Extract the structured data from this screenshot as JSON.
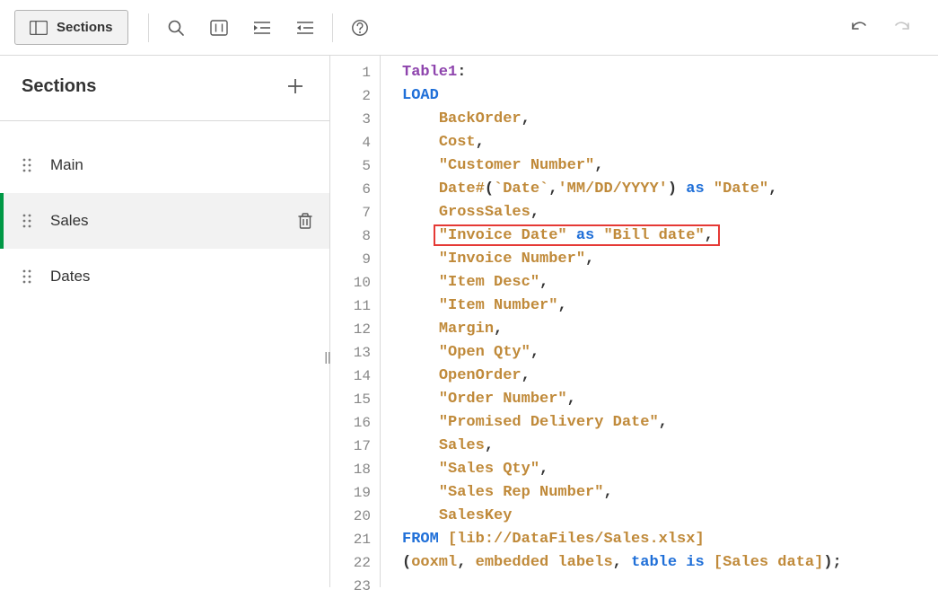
{
  "toolbar": {
    "sections_label": "Sections"
  },
  "sidebar": {
    "title": "Sections",
    "items": [
      {
        "label": "Main",
        "active": false
      },
      {
        "label": "Sales",
        "active": true
      },
      {
        "label": "Dates",
        "active": false
      }
    ]
  },
  "editor": {
    "highlighted_line": 8,
    "lines": [
      {
        "n": 1,
        "indent": 0,
        "tokens": [
          {
            "t": "Table1",
            "c": "tablename"
          },
          {
            "t": ":",
            "c": "punc"
          }
        ]
      },
      {
        "n": 2,
        "indent": 0,
        "tokens": [
          {
            "t": "LOAD",
            "c": "kw"
          }
        ]
      },
      {
        "n": 3,
        "indent": 1,
        "tokens": [
          {
            "t": "BackOrder",
            "c": "field"
          },
          {
            "t": ",",
            "c": "punc"
          }
        ]
      },
      {
        "n": 4,
        "indent": 1,
        "tokens": [
          {
            "t": "Cost",
            "c": "field"
          },
          {
            "t": ",",
            "c": "punc"
          }
        ]
      },
      {
        "n": 5,
        "indent": 1,
        "tokens": [
          {
            "t": "\"Customer Number\"",
            "c": "str"
          },
          {
            "t": ",",
            "c": "punc"
          }
        ]
      },
      {
        "n": 6,
        "indent": 1,
        "tokens": [
          {
            "t": "Date#",
            "c": "field"
          },
          {
            "t": "(",
            "c": "punc"
          },
          {
            "t": "`Date`",
            "c": "field"
          },
          {
            "t": ",",
            "c": "punc"
          },
          {
            "t": "'MM/DD/YYYY'",
            "c": "str"
          },
          {
            "t": ")",
            "c": "punc"
          },
          {
            "t": " ",
            "c": "punc"
          },
          {
            "t": "as",
            "c": "kw"
          },
          {
            "t": " ",
            "c": "punc"
          },
          {
            "t": "\"Date\"",
            "c": "str"
          },
          {
            "t": ",",
            "c": "punc"
          }
        ]
      },
      {
        "n": 7,
        "indent": 1,
        "tokens": [
          {
            "t": "GrossSales",
            "c": "field"
          },
          {
            "t": ",",
            "c": "punc"
          }
        ]
      },
      {
        "n": 8,
        "indent": 1,
        "tokens": [
          {
            "t": "\"Invoice Date\"",
            "c": "str"
          },
          {
            "t": " ",
            "c": "punc"
          },
          {
            "t": "as",
            "c": "kw"
          },
          {
            "t": " ",
            "c": "punc"
          },
          {
            "t": "\"Bill date\"",
            "c": "str"
          },
          {
            "t": ",",
            "c": "punc"
          }
        ]
      },
      {
        "n": 9,
        "indent": 1,
        "tokens": [
          {
            "t": "\"Invoice Number\"",
            "c": "str"
          },
          {
            "t": ",",
            "c": "punc"
          }
        ]
      },
      {
        "n": 10,
        "indent": 1,
        "tokens": [
          {
            "t": "\"Item Desc\"",
            "c": "str"
          },
          {
            "t": ",",
            "c": "punc"
          }
        ]
      },
      {
        "n": 11,
        "indent": 1,
        "tokens": [
          {
            "t": "\"Item Number\"",
            "c": "str"
          },
          {
            "t": ",",
            "c": "punc"
          }
        ]
      },
      {
        "n": 12,
        "indent": 1,
        "tokens": [
          {
            "t": "Margin",
            "c": "field"
          },
          {
            "t": ",",
            "c": "punc"
          }
        ]
      },
      {
        "n": 13,
        "indent": 1,
        "tokens": [
          {
            "t": "\"Open Qty\"",
            "c": "str"
          },
          {
            "t": ",",
            "c": "punc"
          }
        ]
      },
      {
        "n": 14,
        "indent": 1,
        "tokens": [
          {
            "t": "OpenOrder",
            "c": "field"
          },
          {
            "t": ",",
            "c": "punc"
          }
        ]
      },
      {
        "n": 15,
        "indent": 1,
        "tokens": [
          {
            "t": "\"Order Number\"",
            "c": "str"
          },
          {
            "t": ",",
            "c": "punc"
          }
        ]
      },
      {
        "n": 16,
        "indent": 1,
        "tokens": [
          {
            "t": "\"Promised Delivery Date\"",
            "c": "str"
          },
          {
            "t": ",",
            "c": "punc"
          }
        ]
      },
      {
        "n": 17,
        "indent": 1,
        "tokens": [
          {
            "t": "Sales",
            "c": "field"
          },
          {
            "t": ",",
            "c": "punc"
          }
        ]
      },
      {
        "n": 18,
        "indent": 1,
        "tokens": [
          {
            "t": "\"Sales Qty\"",
            "c": "str"
          },
          {
            "t": ",",
            "c": "punc"
          }
        ]
      },
      {
        "n": 19,
        "indent": 1,
        "tokens": [
          {
            "t": "\"Sales Rep Number\"",
            "c": "str"
          },
          {
            "t": ",",
            "c": "punc"
          }
        ]
      },
      {
        "n": 20,
        "indent": 1,
        "tokens": [
          {
            "t": "SalesKey",
            "c": "field"
          }
        ]
      },
      {
        "n": 21,
        "indent": 0,
        "tokens": [
          {
            "t": "FROM",
            "c": "kw"
          },
          {
            "t": " ",
            "c": "punc"
          },
          {
            "t": "[lib://DataFiles/Sales.xlsx]",
            "c": "field"
          }
        ]
      },
      {
        "n": 22,
        "indent": 0,
        "tokens": [
          {
            "t": "(",
            "c": "punc"
          },
          {
            "t": "ooxml",
            "c": "field"
          },
          {
            "t": ", ",
            "c": "punc"
          },
          {
            "t": "embedded labels",
            "c": "field"
          },
          {
            "t": ", ",
            "c": "punc"
          },
          {
            "t": "table",
            "c": "kw"
          },
          {
            "t": " ",
            "c": "punc"
          },
          {
            "t": "is",
            "c": "kw"
          },
          {
            "t": " ",
            "c": "punc"
          },
          {
            "t": "[Sales data]",
            "c": "field"
          },
          {
            "t": ");",
            "c": "punc"
          }
        ]
      },
      {
        "n": 23,
        "indent": 0,
        "tokens": []
      }
    ]
  }
}
